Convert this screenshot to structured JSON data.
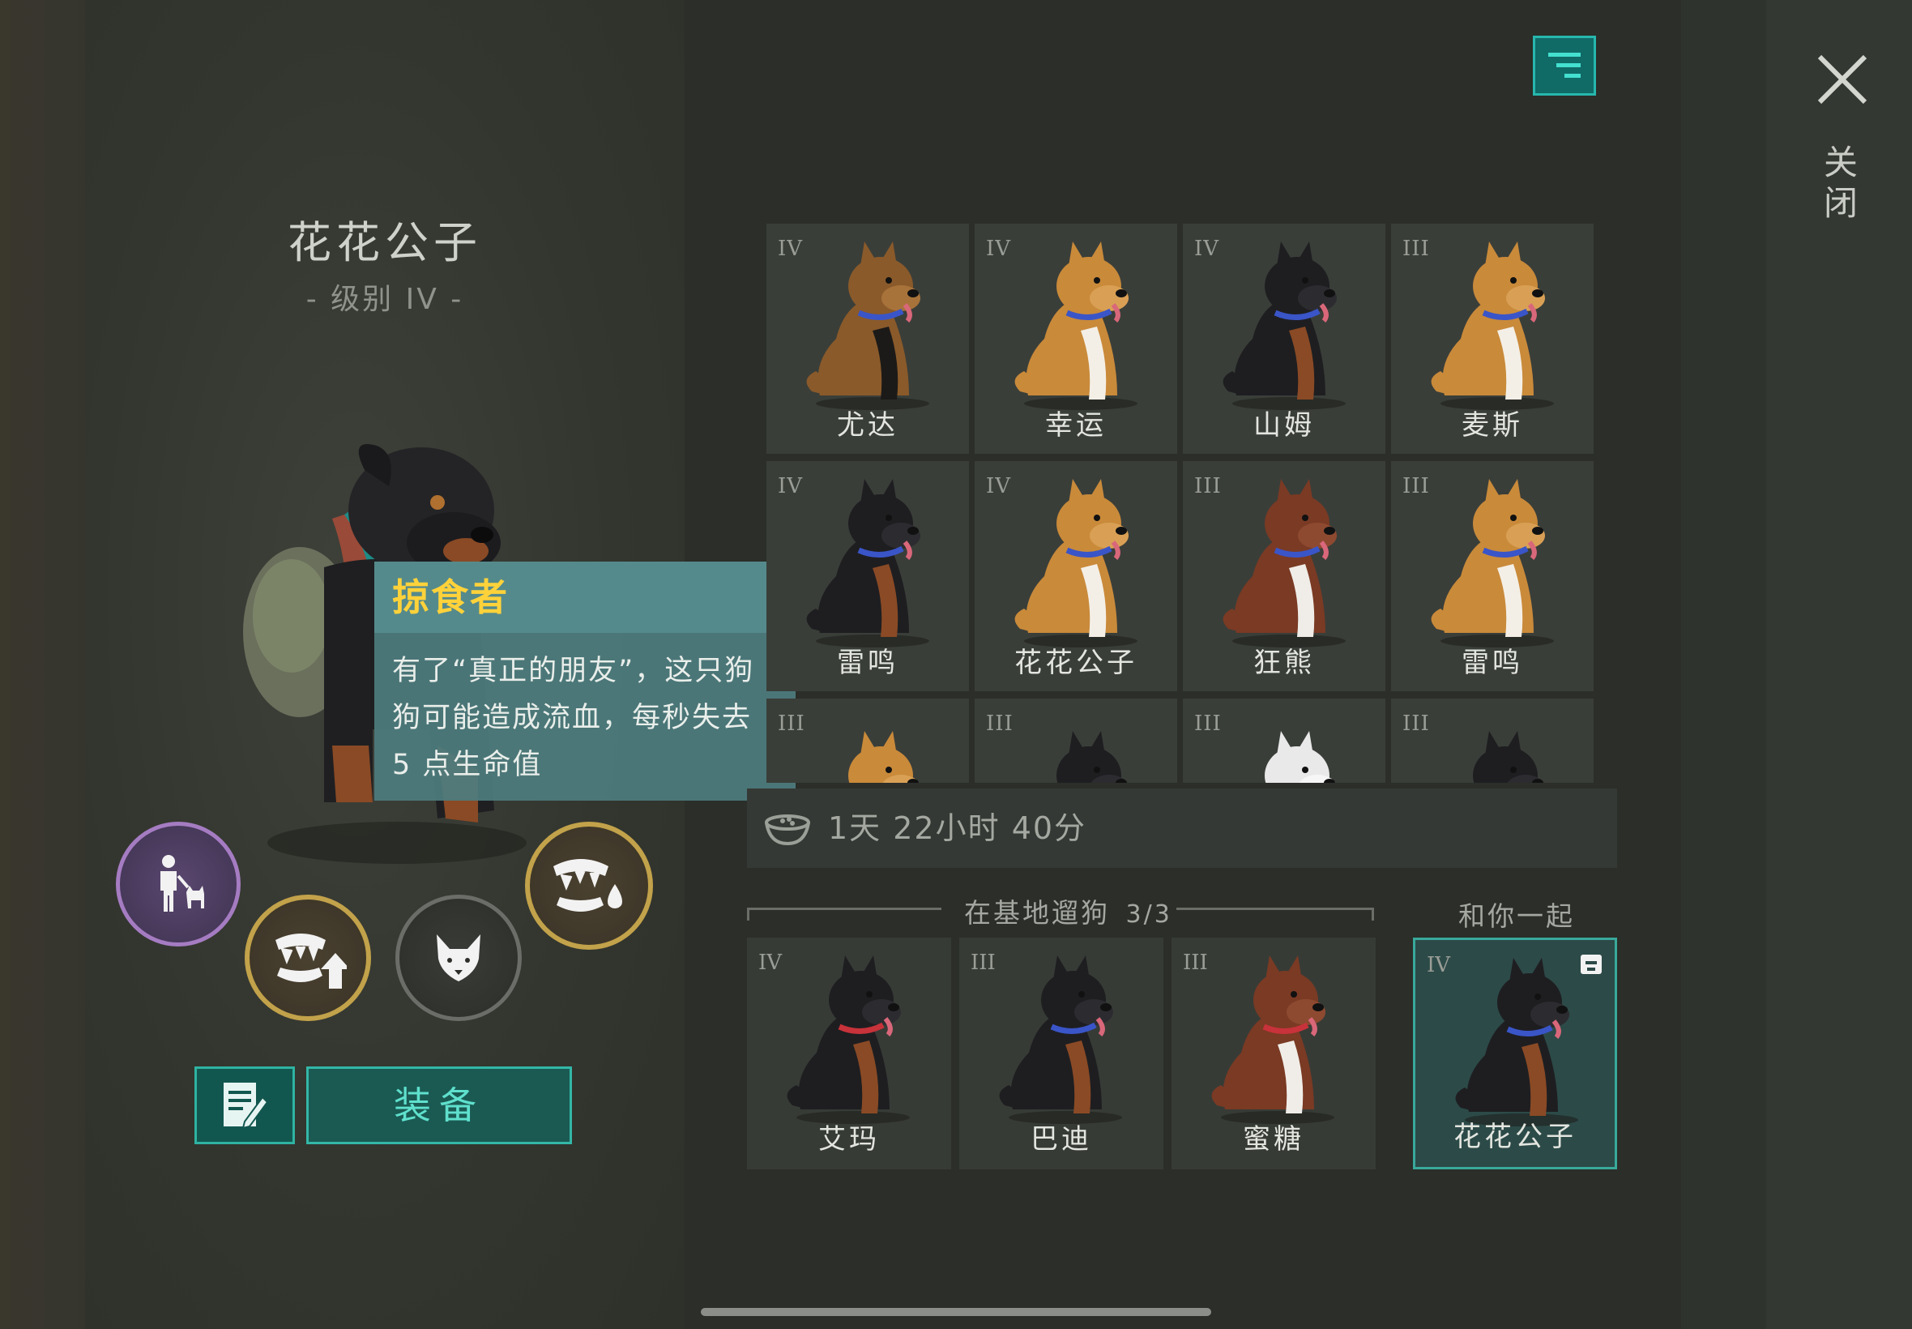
{
  "selected_dog": {
    "name": "花花公子",
    "level": "- 级别 IV -"
  },
  "tooltip": {
    "title": "掠食者",
    "lines": [
      "有了“真正的朋友”，这只狗",
      "狗可能造成流血，每秒失去",
      "5 点生命值"
    ]
  },
  "skills": [
    {
      "icon": "trainer-with-dog-icon",
      "ring": "purple"
    },
    {
      "icon": "fangs-upgrade-icon",
      "ring": "gold"
    },
    {
      "icon": "wolf-head-icon",
      "ring": "gray"
    },
    {
      "icon": "fangs-bleed-icon",
      "ring": "gold"
    }
  ],
  "buttons": {
    "equip": "装备",
    "close": "关闭"
  },
  "dog_list": [
    {
      "rank": "IV",
      "name": "尤达",
      "breed": "shepherd",
      "collar": "blue"
    },
    {
      "rank": "IV",
      "name": "幸运",
      "breed": "corgi",
      "collar": "blue"
    },
    {
      "rank": "IV",
      "name": "山姆",
      "breed": "rottweiler",
      "collar": "blue"
    },
    {
      "rank": "III",
      "name": "麦斯",
      "breed": "corgi",
      "collar": "blue"
    },
    {
      "rank": "IV",
      "name": "雷鸣",
      "breed": "rottweiler",
      "collar": "blue"
    },
    {
      "rank": "IV",
      "name": "花花公子",
      "breed": "corgi",
      "collar": "blue"
    },
    {
      "rank": "III",
      "name": "狂熊",
      "breed": "husky",
      "collar": "blue"
    },
    {
      "rank": "III",
      "name": "雷鸣",
      "breed": "corgi",
      "collar": "blue"
    },
    {
      "rank": "III",
      "name": "",
      "breed": "corgi",
      "collar": "blue"
    },
    {
      "rank": "III",
      "name": "",
      "breed": "rottweiler",
      "collar": "blue"
    },
    {
      "rank": "III",
      "name": "",
      "breed": "white",
      "collar": "blue"
    },
    {
      "rank": "III",
      "name": "",
      "breed": "rottweiler",
      "collar": "blue"
    }
  ],
  "timer": "1天 22小时 40分",
  "base_section": {
    "title": "在基地遛狗",
    "count": "3/3",
    "dogs": [
      {
        "rank": "IV",
        "name": "艾玛",
        "breed": "rottweiler",
        "collar": "red"
      },
      {
        "rank": "III",
        "name": "巴迪",
        "breed": "rottweiler",
        "collar": "blue"
      },
      {
        "rank": "III",
        "name": "蜜糖",
        "breed": "husky",
        "collar": "red"
      }
    ]
  },
  "with_you_section": {
    "title": "和你一起",
    "dog": {
      "rank": "IV",
      "name": "花花公子",
      "breed": "rottweiler",
      "collar": "blue"
    }
  },
  "colors": {
    "accent": "#33b7a7",
    "tooltip_title": "#ffd23a",
    "skill_purple": "#a57cc2",
    "skill_gold": "#c2a24a"
  }
}
